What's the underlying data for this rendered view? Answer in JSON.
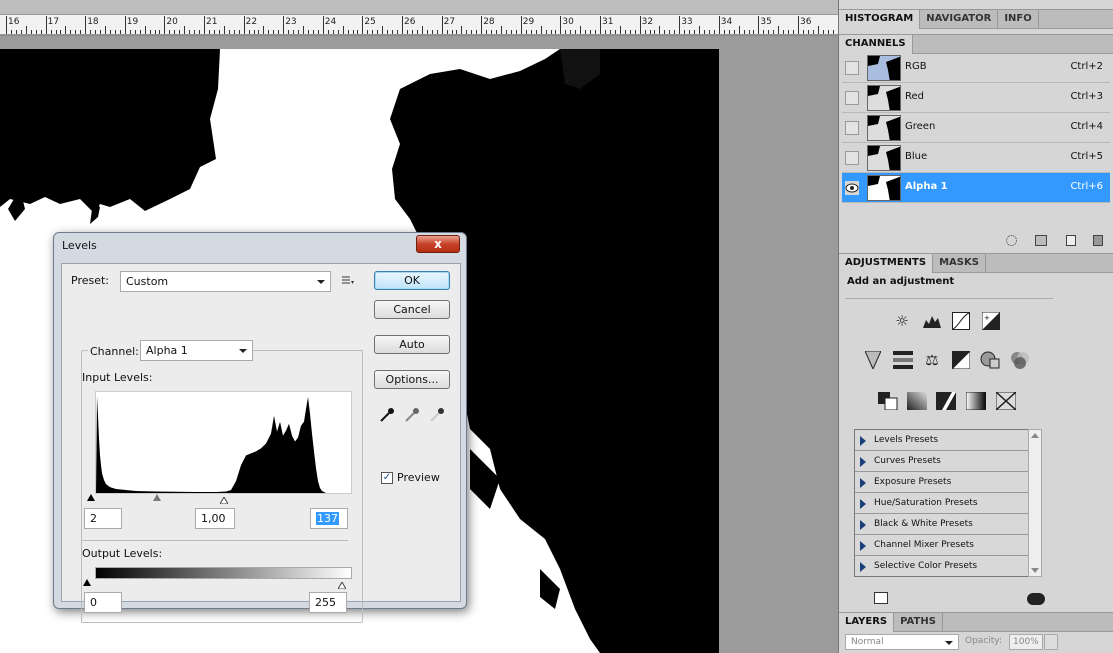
{
  "ruler": {
    "numbers": [
      "16",
      "17",
      "18",
      "19",
      "20",
      "21",
      "22",
      "23",
      "24",
      "25",
      "26",
      "27",
      "28",
      "29",
      "30",
      "31",
      "32",
      "33",
      "34",
      "35",
      "36"
    ]
  },
  "panel_top": {
    "tabs": [
      "HISTOGRAM",
      "NAVIGATOR",
      "INFO"
    ]
  },
  "channels": {
    "tab": "CHANNELS",
    "rows": [
      {
        "name": "RGB",
        "shortcut": "Ctrl+2",
        "visible": false,
        "selected": false
      },
      {
        "name": "Red",
        "shortcut": "Ctrl+3",
        "visible": false,
        "selected": false
      },
      {
        "name": "Green",
        "shortcut": "Ctrl+4",
        "visible": false,
        "selected": false
      },
      {
        "name": "Blue",
        "shortcut": "Ctrl+5",
        "visible": false,
        "selected": false
      },
      {
        "name": "Alpha 1",
        "shortcut": "Ctrl+6",
        "visible": true,
        "selected": true
      }
    ],
    "footer_icons": [
      "dotted-circle-icon",
      "channel-mask-icon",
      "new-channel-icon",
      "trash-icon"
    ]
  },
  "adjustments": {
    "tabs": [
      "ADJUSTMENTS",
      "MASKS"
    ],
    "heading": "Add an adjustment",
    "icons_row1": [
      "brightness-icon",
      "levels-icon",
      "curves-icon",
      "exposure-icon"
    ],
    "icons_row2": [
      "vibrance-icon",
      "hue-saturation-icon",
      "color-balance-icon",
      "black-white-icon",
      "photo-filter-icon",
      "channel-mixer-icon"
    ],
    "icons_row3": [
      "invert-icon",
      "posterize-icon",
      "threshold-icon",
      "gradient-map-icon",
      "selective-color-icon"
    ],
    "presets": [
      "Levels Presets",
      "Curves Presets",
      "Exposure Presets",
      "Hue/Saturation Presets",
      "Black & White Presets",
      "Channel Mixer Presets",
      "Selective Color Presets"
    ]
  },
  "layers": {
    "tabs": [
      "LAYERS",
      "PATHS"
    ],
    "blend_mode": "Normal",
    "opacity_label": "Opacity:",
    "opacity_value": "100%"
  },
  "dialog": {
    "title": "Levels",
    "close": "x",
    "preset_label": "Preset:",
    "preset_value": "Custom",
    "channel_label": "Channel:",
    "channel_value": "Alpha 1",
    "input_levels_label": "Input Levels:",
    "input_black": "2",
    "input_gamma": "1,00",
    "input_white": "137",
    "output_levels_label": "Output Levels:",
    "output_black": "0",
    "output_white": "255",
    "buttons": {
      "ok": "OK",
      "cancel": "Cancel",
      "auto": "Auto",
      "options": "Options..."
    },
    "preview_label": "Preview",
    "preview_checked": true,
    "check_mark": "✓"
  },
  "chart_data": {
    "type": "area",
    "title": "",
    "xlabel": "",
    "ylabel": "",
    "xlim": [
      0,
      255
    ],
    "ylim": [
      0,
      100
    ],
    "x": [
      0,
      1,
      2,
      3,
      4,
      5,
      6,
      8,
      10,
      14,
      20,
      30,
      40,
      60,
      80,
      100,
      120,
      130,
      135,
      140,
      145,
      150,
      155,
      160,
      165,
      170,
      175,
      178,
      181,
      184,
      187,
      190,
      193,
      196,
      199,
      202,
      205,
      208,
      210,
      212,
      214,
      216,
      218,
      220,
      222,
      224,
      226,
      228,
      230,
      240,
      255
    ],
    "values": [
      0,
      98,
      78,
      55,
      38,
      28,
      20,
      13,
      9,
      6,
      4,
      3,
      2,
      1.5,
      1.2,
      1,
      1,
      1.5,
      3,
      12,
      28,
      38,
      40,
      42,
      45,
      50,
      60,
      78,
      62,
      72,
      58,
      63,
      70,
      58,
      52,
      56,
      68,
      72,
      85,
      97,
      80,
      60,
      42,
      25,
      12,
      5,
      2,
      1,
      0,
      0,
      0
    ]
  }
}
